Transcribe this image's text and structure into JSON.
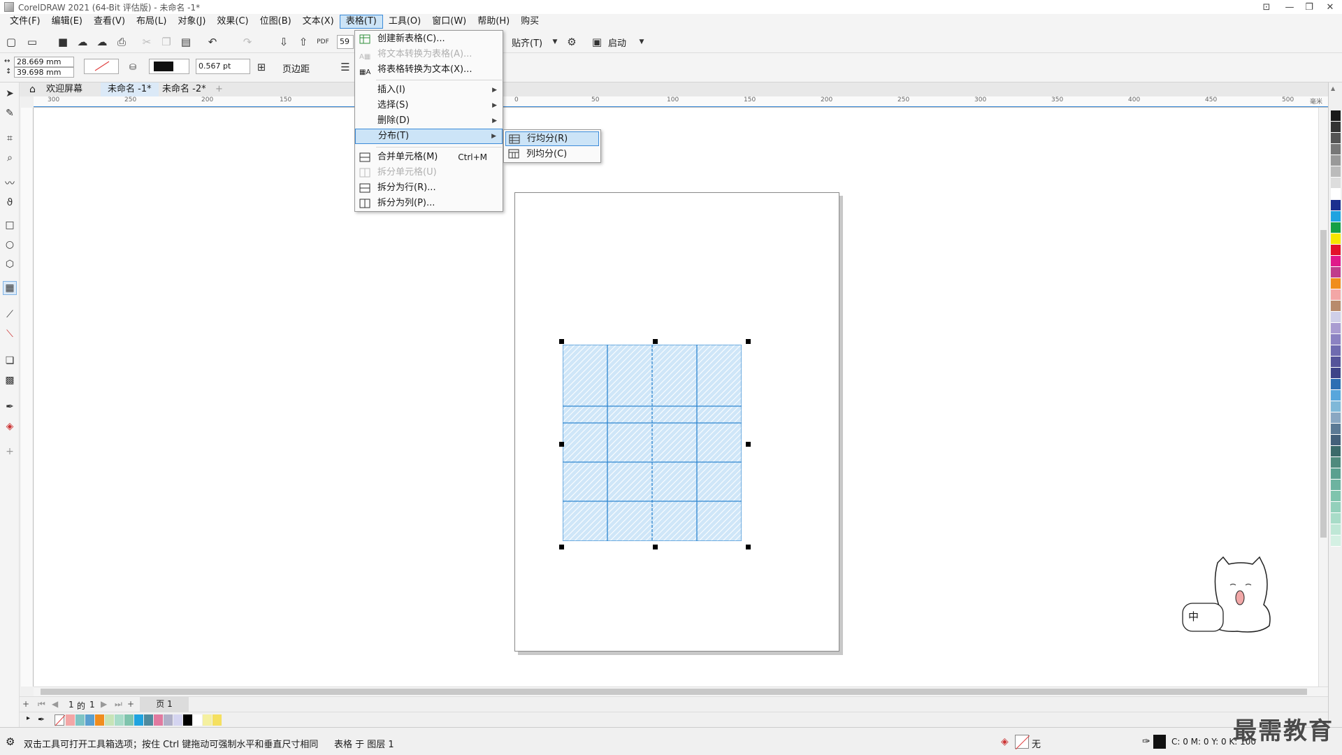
{
  "window": {
    "title": "CorelDRAW 2021 (64-Bit 评估版) - 未命名 -1*",
    "minimize": "—",
    "restore": "❐",
    "close": "✕",
    "extra": "⊡"
  },
  "menu": [
    {
      "label": "文件(F)"
    },
    {
      "label": "编辑(E)"
    },
    {
      "label": "查看(V)"
    },
    {
      "label": "布局(L)"
    },
    {
      "label": "对象(J)"
    },
    {
      "label": "效果(C)"
    },
    {
      "label": "位图(B)"
    },
    {
      "label": "文本(X)"
    },
    {
      "label": "表格(T)"
    },
    {
      "label": "工具(O)"
    },
    {
      "label": "窗口(W)"
    },
    {
      "label": "帮助(H)"
    },
    {
      "label": "购买"
    }
  ],
  "toolbar": {
    "zoom_value": "59",
    "snap_label": "贴齐(T)",
    "launch_label": "启动"
  },
  "propbar": {
    "width_value": "28.669 mm",
    "height_value": "39.698 mm",
    "outline_width": "0.567 pt",
    "margin_label": "页边距"
  },
  "doc_tabs": {
    "home_icon": "home-icon",
    "tab1": "欢迎屏幕",
    "tab2": "未命名 -1*",
    "tab3": "未命名 -2*",
    "add": "+"
  },
  "ruler_top": [
    "300",
    "250",
    "200",
    "150",
    "0",
    "50",
    "100",
    "150",
    "200",
    "250",
    "300",
    "350",
    "400",
    "450",
    "500"
  ],
  "ruler_unit": "毫米",
  "table_menu": {
    "create": "创建新表格(C)...",
    "text_to_table": "将文本转换为表格(A)...",
    "table_to_text": "将表格转换为文本(X)...",
    "insert": "插入(I)",
    "select": "选择(S)",
    "delete": "删除(D)",
    "distribute": "分布(T)",
    "merge": "合并单元格(M)",
    "merge_shortcut": "Ctrl+M",
    "split_cells": "拆分单元格(U)",
    "split_rows": "拆分为行(R)...",
    "split_cols": "拆分为列(P)..."
  },
  "distribute_submenu": {
    "rows_even": "行均分(R)",
    "cols_even": "列均分(C)"
  },
  "pagenav": {
    "current": "1",
    "of": "的",
    "total": "1",
    "page_tab": "页 1"
  },
  "status": {
    "hint": "双击工具可打开工具箱选项；按住 Ctrl 键拖动可强制水平和垂直尺寸相同",
    "layer": "表格 于 图层 1",
    "fill_none": "无",
    "color_readout": "C: 0 M: 0 Y: 0 K: 100"
  },
  "watermark": "最需教育",
  "sticker_text": "中",
  "colors": {
    "accent": "#3c8bd9",
    "table_fill": "#cfe6f8",
    "table_line": "#2f86d0"
  }
}
